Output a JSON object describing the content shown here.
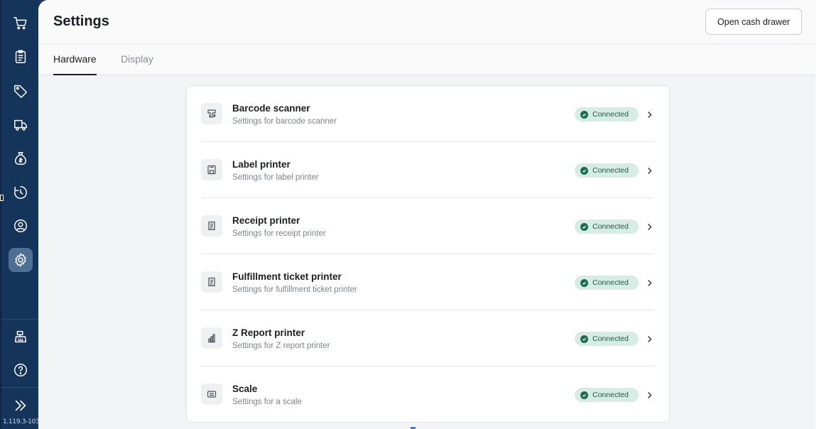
{
  "sidebar": {
    "items": [
      {
        "name": "cart-icon"
      },
      {
        "name": "clipboard-icon"
      },
      {
        "name": "tags-icon"
      },
      {
        "name": "truck-icon"
      },
      {
        "name": "money-bag-icon"
      },
      {
        "name": "history-timer-icon"
      },
      {
        "name": "customer-search-icon"
      },
      {
        "name": "gear-icon",
        "active": true
      },
      {
        "name": "cash-register-icon"
      },
      {
        "name": "help-icon"
      },
      {
        "name": "expand-icon"
      }
    ],
    "version": "1.119.3-103-"
  },
  "header": {
    "title": "Settings",
    "cash_drawer_button": "Open cash drawer",
    "tabs": [
      {
        "label": "Hardware",
        "active": true
      },
      {
        "label": "Display",
        "active": false
      }
    ]
  },
  "devices": [
    {
      "title": "Barcode scanner",
      "subtitle": "Settings for barcode scanner",
      "status": "Connected",
      "icon": "barcode-scanner-icon"
    },
    {
      "title": "Label printer",
      "subtitle": "Settings for label printer",
      "status": "Connected",
      "icon": "label-printer-icon"
    },
    {
      "title": "Receipt printer",
      "subtitle": "Settings for receipt printer",
      "status": "Connected",
      "icon": "receipt-icon"
    },
    {
      "title": "Fulfillment ticket printer",
      "subtitle": "Settings for fulfillment ticket printer",
      "status": "Connected",
      "icon": "ticket-icon"
    },
    {
      "title": "Z Report printer",
      "subtitle": "Settings for Z report printer",
      "status": "Connected",
      "icon": "bar-chart-icon"
    },
    {
      "title": "Scale",
      "subtitle": "Settings for a scale",
      "status": "Connected",
      "icon": "scale-icon"
    }
  ],
  "colors": {
    "sidebar": "#143459",
    "active_nav": "#4d6f93",
    "badge_bg": "#d6ece4",
    "badge_text": "#1c5a45"
  }
}
